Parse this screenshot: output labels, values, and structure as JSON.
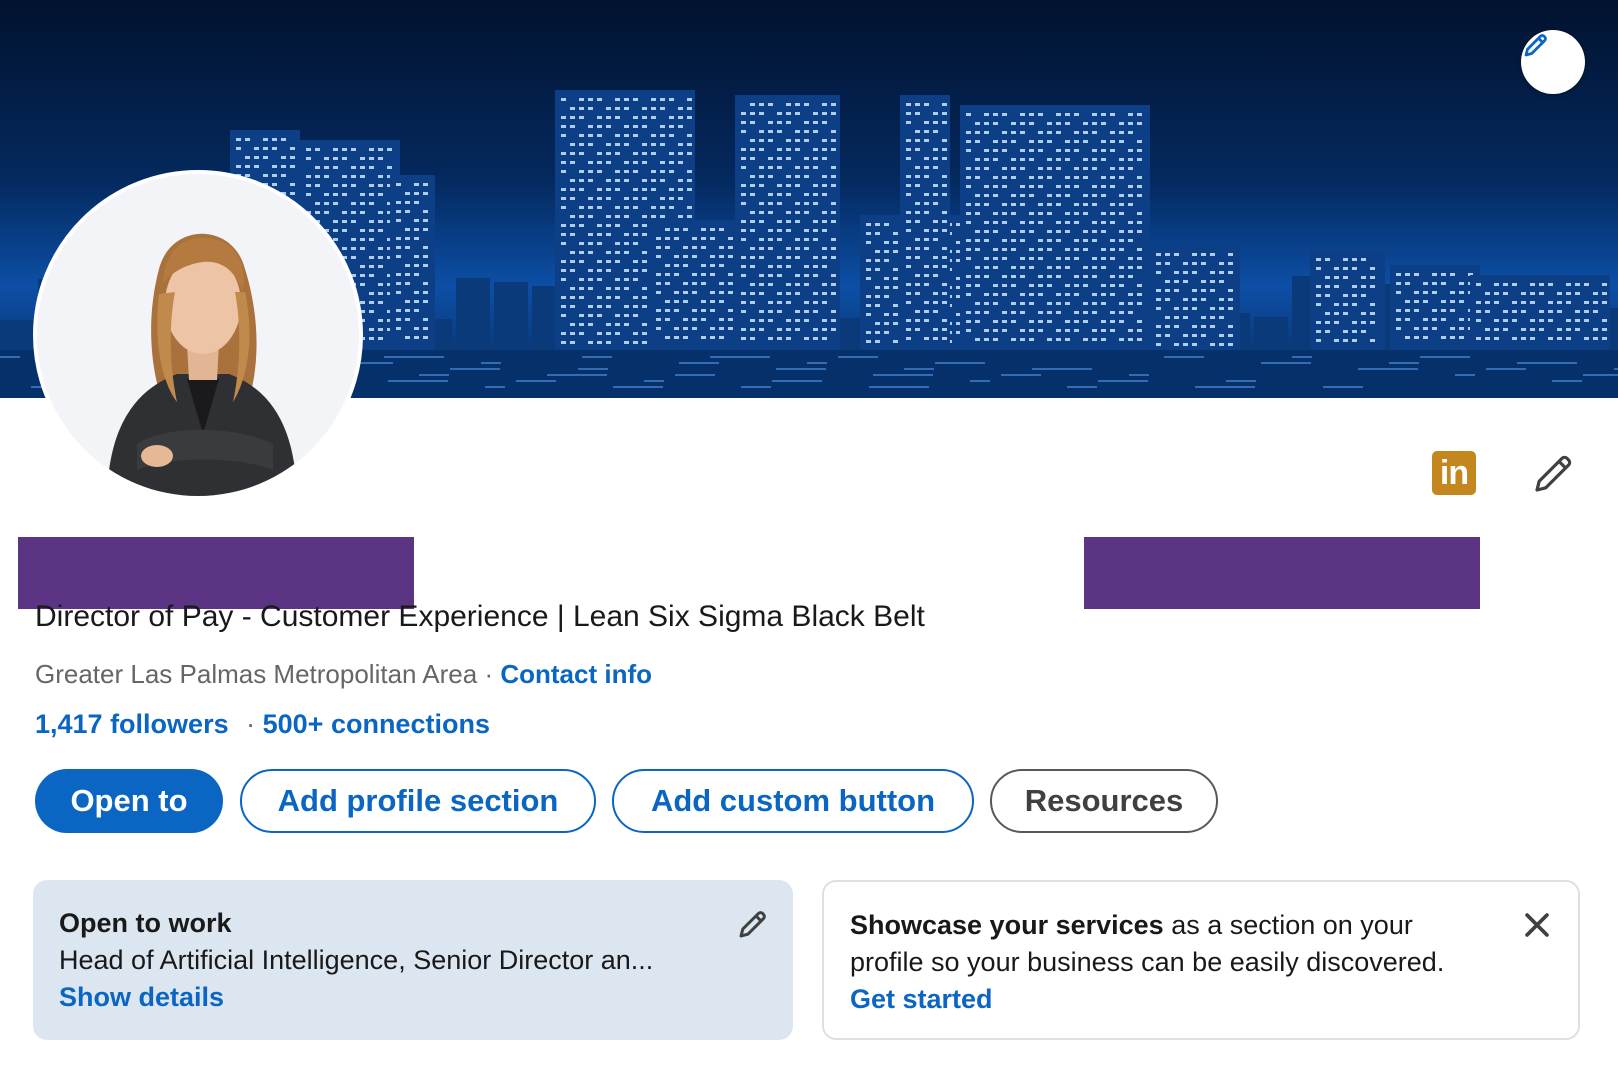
{
  "colors": {
    "brand_blue": "#0a66c2",
    "redaction": "#5b3583",
    "linkedin_badge": "#c4861e",
    "open_to_work_bg": "#dce6f1"
  },
  "icons": {
    "banner_edit": "pencil-icon",
    "linkedin_badge": "linkedin-logo-icon",
    "intro_edit": "pencil-icon",
    "open_to_work_edit": "pencil-icon",
    "services_close": "close-icon"
  },
  "linkedin_badge_text": "in",
  "headline": "Director of Pay - Customer Experience | Lean Six Sigma Black Belt",
  "location": "Greater Las Palmas Metropolitan Area",
  "separator": "·",
  "contact_info": "Contact info",
  "followers": "1,417 followers",
  "connections": "500+ connections",
  "buttons": {
    "open_to": "Open to",
    "add_profile_section": "Add profile section",
    "add_custom_button": "Add custom button",
    "resources": "Resources"
  },
  "open_to_work": {
    "title": "Open to work",
    "roles": "Head of Artificial Intelligence, Senior Director an...",
    "link": "Show details"
  },
  "services": {
    "bold": "Showcase your services",
    "rest": " as a section on your",
    "line2": "profile so your business can be easily discovered.",
    "link": "Get started"
  }
}
